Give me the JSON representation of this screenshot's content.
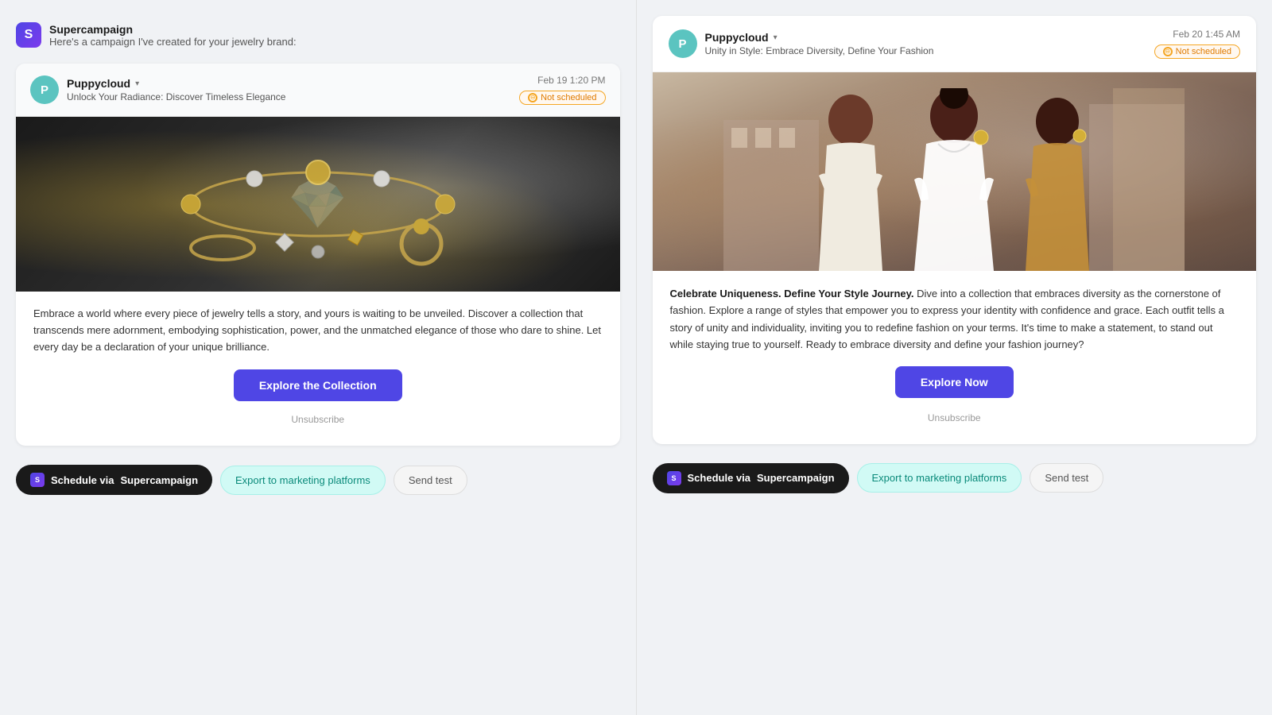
{
  "left": {
    "app_name": "Supercampaign",
    "app_description": "Here's a campaign I've created for your jewelry brand:",
    "email1": {
      "sender": "Puppycloud",
      "sender_initial": "P",
      "sender_chevron": "▾",
      "subject": "Unlock Your Radiance: Discover Timeless Elegance",
      "date": "Feb 19 1:20 PM",
      "status": "Not scheduled",
      "body": "Embrace a world where every piece of jewelry tells a story, and yours is waiting to be unveiled. Discover a collection that transcends mere adornment, embodying sophistication, power, and the unmatched elegance of those who dare to shine. Let every day be a declaration of your unique brilliance.",
      "cta_label": "Explore the Collection",
      "unsubscribe": "Unsubscribe"
    },
    "actions": {
      "schedule_label": "Schedule via",
      "schedule_brand": "Supercampaign",
      "export_label": "Export to marketing platforms",
      "send_test_label": "Send test"
    }
  },
  "right": {
    "email2": {
      "sender": "Puppycloud",
      "sender_initial": "P",
      "sender_chevron": "▾",
      "subject": "Unity in Style: Embrace Diversity, Define Your Fashion",
      "date": "Feb 20 1:45 AM",
      "status": "Not scheduled",
      "bold_intro": "Celebrate Uniqueness. Define Your Style Journey.",
      "body": " Dive into a collection that embraces diversity as the cornerstone of fashion. Explore a range of styles that empower you to express your identity with confidence and grace. Each outfit tells a story of unity and individuality, inviting you to redefine fashion on your terms. It's time to make a statement, to stand out while staying true to yourself. Ready to embrace diversity and define your fashion journey?",
      "cta_label": "Explore Now",
      "unsubscribe": "Unsubscribe"
    },
    "actions": {
      "schedule_label": "Schedule via",
      "schedule_brand": "Supercampaign",
      "export_label": "Export to marketing platforms",
      "send_test_label": "Send test"
    }
  },
  "icons": {
    "not_scheduled_symbol": "⊖",
    "app_symbol": "S"
  }
}
